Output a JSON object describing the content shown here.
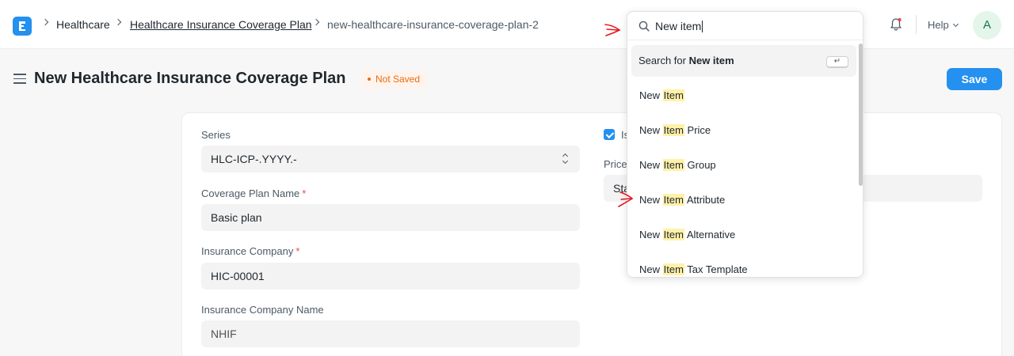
{
  "navbar": {
    "breadcrumbs": [
      "Healthcare",
      "Healthcare Insurance Coverage Plan",
      "new-healthcare-insurance-coverage-plan-2"
    ],
    "help_label": "Help",
    "avatar_initial": "A"
  },
  "page": {
    "title": "New Healthcare Insurance Coverage Plan",
    "status_badge": "Not Saved",
    "save_label": "Save"
  },
  "form": {
    "series": {
      "label": "Series",
      "value": "HLC-ICP-.YYYY.-"
    },
    "coverage_plan_name": {
      "label": "Coverage Plan Name",
      "value": "Basic plan",
      "required": "*"
    },
    "insurance_company": {
      "label": "Insurance Company",
      "value": "HIC-00001",
      "required": "*"
    },
    "insurance_company_name": {
      "label": "Insurance Company Name",
      "value": "NHIF"
    },
    "checkbox_label_partial": "Is",
    "price_label_partial": "Price",
    "price_value_partial": "Sta"
  },
  "search": {
    "query": "New item",
    "search_for_prefix": "Search for ",
    "search_for_term": "New item",
    "enter_key": "↵",
    "results": [
      {
        "prefix": "New ",
        "match": "Item",
        "suffix": ""
      },
      {
        "prefix": "New ",
        "match": "Item",
        "suffix": " Price"
      },
      {
        "prefix": "New ",
        "match": "Item",
        "suffix": " Group"
      },
      {
        "prefix": "New ",
        "match": "Item",
        "suffix": " Attribute"
      },
      {
        "prefix": "New ",
        "match": "Item",
        "suffix": " Alternative"
      },
      {
        "prefix": "New ",
        "match": "Item",
        "suffix": " Tax Template"
      }
    ]
  },
  "colors": {
    "primary": "#2490ef",
    "badge_text": "#e86c13",
    "badge_bg": "#fff4ed",
    "highlight": "#fff1a8",
    "annotation": "#e8141c"
  }
}
